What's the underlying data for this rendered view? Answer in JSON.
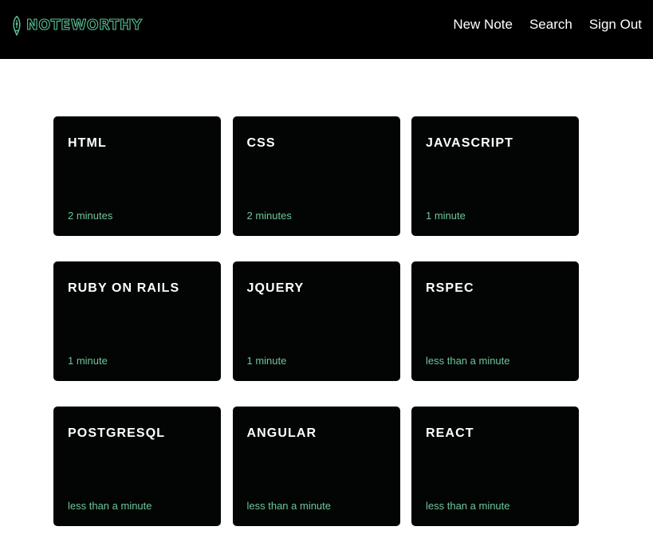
{
  "brand": {
    "name": "NOTEWORTHY",
    "accent_color": "#5cc596",
    "icon": "pen-nib-icon"
  },
  "nav": {
    "new_note": "New Note",
    "search": "Search",
    "sign_out": "Sign Out"
  },
  "notes": [
    {
      "title": "HTML",
      "time": "2 minutes"
    },
    {
      "title": "CSS",
      "time": "2 minutes"
    },
    {
      "title": "JAVASCRIPT",
      "time": "1 minute"
    },
    {
      "title": "RUBY ON RAILS",
      "time": "1 minute"
    },
    {
      "title": "JQUERY",
      "time": "1 minute"
    },
    {
      "title": "RSPEC",
      "time": "less than a minute"
    },
    {
      "title": "POSTGRESQL",
      "time": "less than a minute"
    },
    {
      "title": "ANGULAR",
      "time": "less than a minute"
    },
    {
      "title": "REACT",
      "time": "less than a minute"
    }
  ]
}
